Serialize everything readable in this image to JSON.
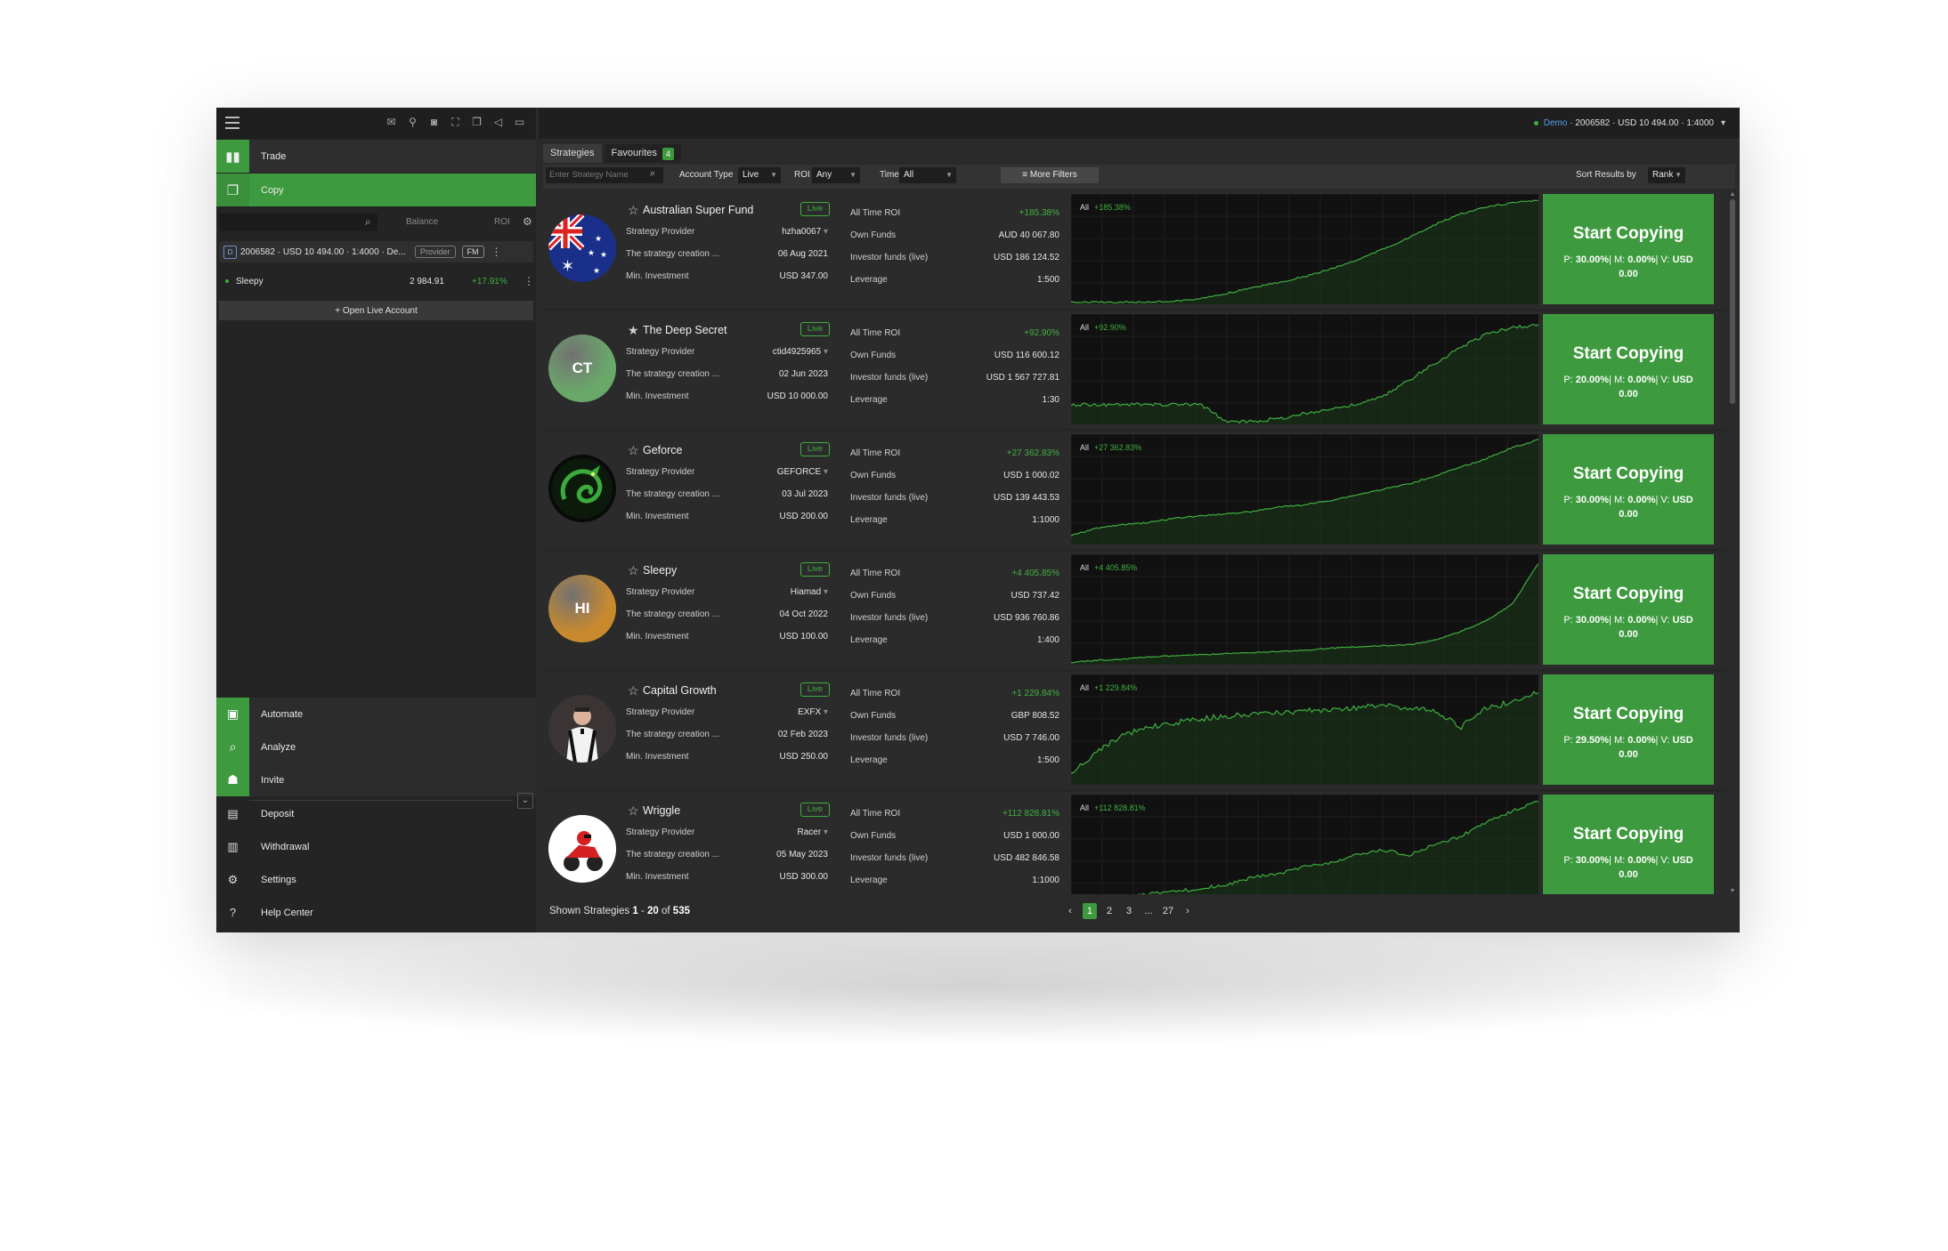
{
  "sidebar": {
    "nav": {
      "trade": "Trade",
      "copy": "Copy"
    },
    "list_header": {
      "balance": "Balance",
      "roi": "ROI"
    },
    "account": {
      "type_badge": "D",
      "summary": "2006582 · USD 10 494.00 · 1:4000 · De...",
      "provider_label": "Provider",
      "fm_label": "FM"
    },
    "strategy_row": {
      "name": "Sleepy",
      "balance": "2 984.91",
      "roi": "+17.91%"
    },
    "open_live_label": "+ Open Live Account",
    "bottom_nav": [
      "Automate",
      "Analyze",
      "Invite",
      "Deposit",
      "Withdrawal",
      "Settings",
      "Help Center"
    ]
  },
  "topbar": {
    "demo": "Demo",
    "account_info": "· 2006582 · USD 10 494.00 · 1:4000"
  },
  "tabs": {
    "strategies": "Strategies",
    "favourites": "Favourites",
    "favourites_count": "4"
  },
  "filters": {
    "search_placeholder": "Enter Strategy Name",
    "account_type_label": "Account Type",
    "account_type_value": "Live",
    "roi_label": "ROI",
    "roi_value": "Any",
    "time_label": "Time",
    "time_value": "All",
    "more_filters": "More Filters",
    "sort_label": "Sort Results by",
    "sort_value": "Rank"
  },
  "labels": {
    "live": "Live",
    "strategy_provider": "Strategy Provider",
    "creation": "The strategy creation ...",
    "min_investment": "Min. Investment",
    "all_time_roi": "All Time ROI",
    "own_funds": "Own Funds",
    "investor_funds": "Investor funds (live)",
    "leverage": "Leverage",
    "chart_all": "All",
    "start_copying": "Start Copying"
  },
  "strategies": [
    {
      "name": "Australian Super Fund",
      "favourite": false,
      "provider": "hzha0067",
      "created": "06 Aug 2021",
      "min_investment": "USD 347.00",
      "roi": "+185.38%",
      "own_funds": "AUD 40 067.80",
      "investor_funds": "USD 186 124.52",
      "leverage": "1:500",
      "fees_p": "30.00%",
      "fees_m": "0.00%",
      "fees_v": "USD",
      "fees_v2": "0.00",
      "avatar": "flag-au",
      "avatar_text": "",
      "color": "#1a3a8c"
    },
    {
      "name": "The Deep Secret",
      "favourite": true,
      "provider": "ctid4925965",
      "created": "02 Jun 2023",
      "min_investment": "USD 10 000.00",
      "roi": "+92.90%",
      "own_funds": "USD 116 600.12",
      "investor_funds": "USD 1 567 727.81",
      "leverage": "1:30",
      "fees_p": "20.00%",
      "fees_m": "0.00%",
      "fees_v": "USD",
      "fees_v2": "0.00",
      "avatar": "initials",
      "avatar_text": "CT",
      "color": "#6aa86a"
    },
    {
      "name": "Geforce",
      "favourite": false,
      "provider": "GEFORCE",
      "created": "03 Jul 2023",
      "min_investment": "USD 200.00",
      "roi": "+27 362.83%",
      "own_funds": "USD 1 000.02",
      "investor_funds": "USD 139 443.53",
      "leverage": "1:1000",
      "fees_p": "30.00%",
      "fees_m": "0.00%",
      "fees_v": "USD",
      "fees_v2": "0.00",
      "avatar": "dragon",
      "avatar_text": "",
      "color": "#1d4a1d"
    },
    {
      "name": "Sleepy",
      "favourite": false,
      "provider": "Hiamad",
      "created": "04 Oct 2022",
      "min_investment": "USD 100.00",
      "roi": "+4 405.85%",
      "own_funds": "USD 737.42",
      "investor_funds": "USD 936 760.86",
      "leverage": "1:400",
      "fees_p": "30.00%",
      "fees_m": "0.00%",
      "fees_v": "USD",
      "fees_v2": "0.00",
      "avatar": "initials",
      "avatar_text": "HI",
      "color": "#c98a2e"
    },
    {
      "name": "Capital Growth",
      "favourite": false,
      "provider": "EXFX",
      "created": "02 Feb 2023",
      "min_investment": "USD 250.00",
      "roi": "+1 229.84%",
      "own_funds": "GBP 808.52",
      "investor_funds": "USD 7 746.00",
      "leverage": "1:500",
      "fees_p": "29.50%",
      "fees_m": "0.00%",
      "fees_v": "USD",
      "fees_v2": "0.00",
      "avatar": "person",
      "avatar_text": "",
      "color": "#2a2a2a"
    },
    {
      "name": "Wriggle",
      "favourite": false,
      "provider": "Racer",
      "created": "05 May 2023",
      "min_investment": "USD 300.00",
      "roi": "+112 828.81%",
      "own_funds": "USD 1 000.00",
      "investor_funds": "USD 482 846.58",
      "leverage": "1:1000",
      "fees_p": "30.00%",
      "fees_m": "0.00%",
      "fees_v": "USD",
      "fees_v2": "0.00",
      "avatar": "racer",
      "avatar_text": "",
      "color": "#ffffff"
    }
  ],
  "footer": {
    "shown_prefix": "Shown Strategies",
    "from": "1",
    "dash": "-",
    "to": "20",
    "of": "of",
    "total": "535",
    "pages": [
      "1",
      "2",
      "3",
      "...",
      "27"
    ],
    "current_page": "1"
  },
  "colors": {
    "accent": "#3e9a3e",
    "positive": "#40b040",
    "demo": "#4f9ff0"
  }
}
